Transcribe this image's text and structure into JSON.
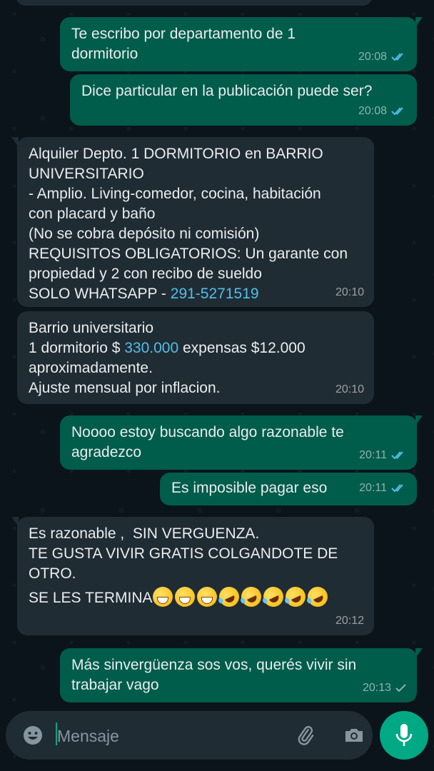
{
  "colors": {
    "background": "#0b141a",
    "outgoing_bubble": "#005c4b",
    "incoming_bubble": "#202c33",
    "read_ticks": "#53bdeb",
    "link": "#53bdeb",
    "accent": "#00a884"
  },
  "messages": [
    {
      "direction": "out",
      "text": "Te escribo por departamento de 1\ndormitorio",
      "time": "20:08",
      "status": "read"
    },
    {
      "direction": "out",
      "text": "Dice particular en la publicación puede ser?",
      "time": "20:08",
      "status": "read"
    },
    {
      "direction": "in",
      "text": "Alquiler Depto. 1 DORMITORIO en BARRIO\nUNIVERSITARIO\n- Amplio. Living-comedor, cocina, habitación\ncon placard y baño\n(No se cobra depósito ni comisión)\nREQUISITOS OBLIGATORIOS: Un garante con\npropiedad y 2 con recibo de sueldo\nSOLO WHATSAPP - ",
      "link": "291-5271519",
      "time": "20:10"
    },
    {
      "direction": "in",
      "text_before": "Barrio universitario\n1 dormitorio $ ",
      "link": "330.000",
      "text_after": " expensas $12.000\naproximadamente.\nAjuste mensual por inflacion.",
      "time": "20:10"
    },
    {
      "direction": "out",
      "text": "Noooo estoy buscando algo razonable te\nagradezco",
      "time": "20:11",
      "status": "read"
    },
    {
      "direction": "out",
      "text": "Es imposible pagar eso",
      "time": "20:11",
      "status": "read"
    },
    {
      "direction": "in",
      "text": "Es razonable ,  SIN VERGUENZA.\nTE GUSTA VIVIR GRATIS COLGANDOTE DE\nOTRO.",
      "last_line": "SE LES TERMINA",
      "emojis": [
        "grinning-face",
        "grinning-face",
        "grinning-face",
        "rolling-on-floor-laughing",
        "rolling-on-floor-laughing",
        "rolling-on-floor-laughing",
        "rolling-on-floor-laughing",
        "rolling-on-floor-laughing"
      ],
      "time": "20:12"
    },
    {
      "direction": "out",
      "text": "Más sinvergüenza sos vos, querés vivir sin\ntrabajar vago",
      "time": "20:13",
      "status": "delivered"
    }
  ],
  "composer": {
    "placeholder": "Mensaje",
    "icons": [
      "emoji-icon",
      "paperclip-icon",
      "camera-icon",
      "mic-icon"
    ]
  }
}
